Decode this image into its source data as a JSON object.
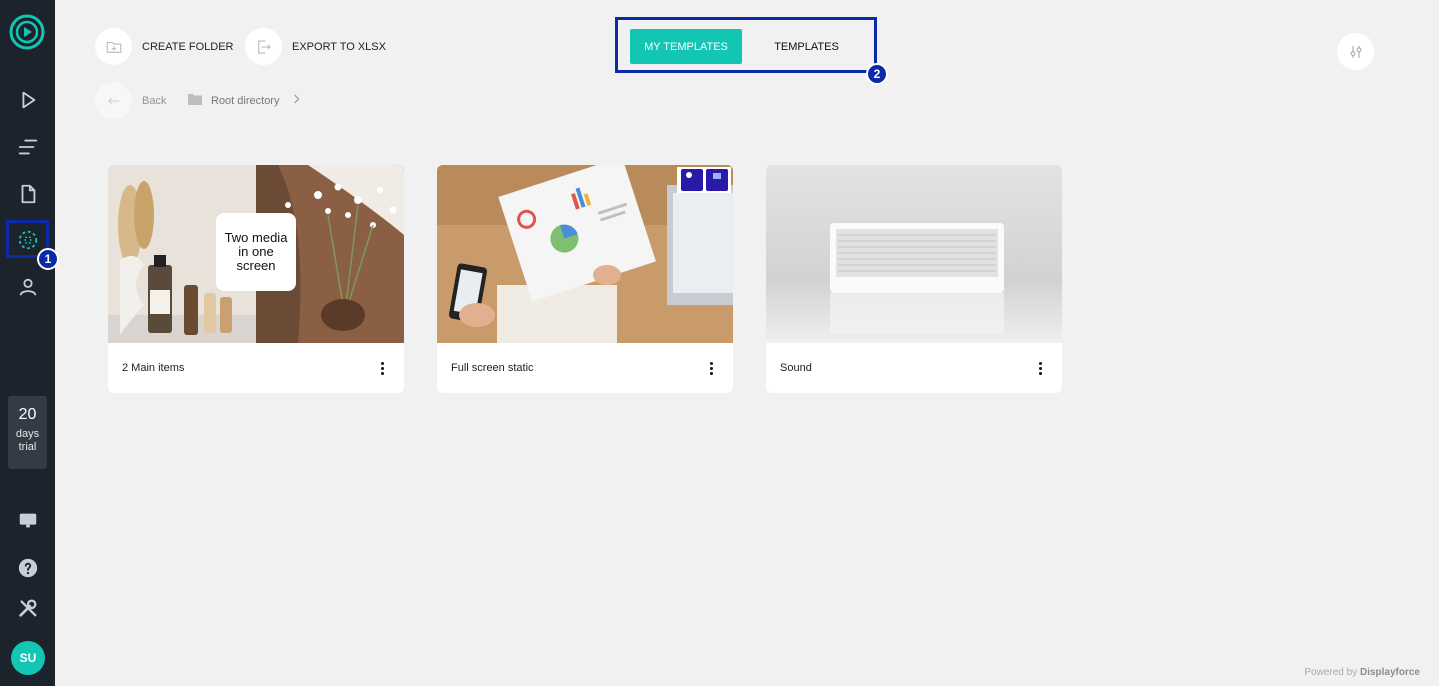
{
  "sidebar": {
    "items": [
      {
        "name": "play-icon"
      },
      {
        "name": "playlist-icon"
      },
      {
        "name": "document-icon"
      },
      {
        "name": "templates-icon"
      },
      {
        "name": "user-icon"
      }
    ],
    "trial": {
      "days": "20",
      "label_line1": "days",
      "label_line2": "trial"
    },
    "bottom_icons": [
      "monitor-icon",
      "help-icon",
      "tools-icon"
    ],
    "avatar_initials": "SU",
    "callout_1": "1"
  },
  "toolbar": {
    "create_folder_label": "CREATE FOLDER",
    "export_label": "EXPORT TO XLSX",
    "back_label": "Back",
    "breadcrumb_root": "Root directory"
  },
  "tabs": {
    "my_templates": "MY TEMPLATES",
    "templates": "TEMPLATES",
    "callout_2": "2"
  },
  "cards": [
    {
      "title": "2 Main items",
      "overlay_line1": "Two media",
      "overlay_line2": "in one",
      "overlay_line3": "screen"
    },
    {
      "title": "Full screen static"
    },
    {
      "title": "Sound"
    }
  ],
  "footer": {
    "powered_by": "Powered by",
    "brand": "Displayforce"
  },
  "colors": {
    "accent": "#13c6b3",
    "sidebar": "#1c232c",
    "callout": "#0b2aa8",
    "background": "#f1f1f1"
  }
}
